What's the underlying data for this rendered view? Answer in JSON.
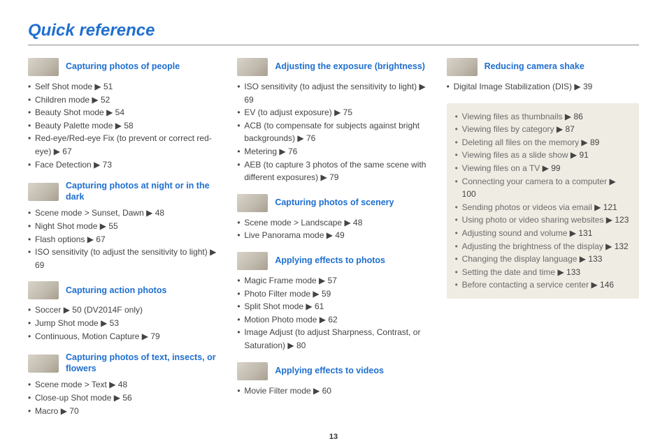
{
  "title": "Quick reference",
  "page_number": "13",
  "columns": [
    [
      {
        "title": "Capturing photos of people",
        "items": [
          {
            "text": "Self Shot mode",
            "page": "51"
          },
          {
            "text": "Children mode",
            "page": "52"
          },
          {
            "text": "Beauty Shot mode",
            "page": "54"
          },
          {
            "text": "Beauty Palette mode",
            "page": "58"
          },
          {
            "text": "Red-eye/Red-eye Fix (to prevent or correct red-eye)",
            "page": "67"
          },
          {
            "text": "Face Detection",
            "page": "73"
          }
        ]
      },
      {
        "title": "Capturing photos at night or in the dark",
        "items": [
          {
            "text": "Scene mode > Sunset, Dawn",
            "page": "48"
          },
          {
            "text": "Night Shot mode",
            "page": "55"
          },
          {
            "text": "Flash options",
            "page": "67"
          },
          {
            "text": "ISO sensitivity (to adjust the sensitivity to light)",
            "page": "69"
          }
        ]
      },
      {
        "title": "Capturing action photos",
        "items": [
          {
            "text": "Soccer ",
            "page": "50 (DV2014F only)"
          },
          {
            "text": "Jump Shot mode",
            "page": "53"
          },
          {
            "text": "Continuous, Motion Capture",
            "page": "79"
          }
        ]
      },
      {
        "title": "Capturing photos of text, insects, or flowers",
        "items": [
          {
            "text": "Scene mode > Text",
            "page": "48"
          },
          {
            "text": "Close-up Shot mode",
            "page": "56"
          },
          {
            "text": "Macro",
            "page": "70"
          }
        ]
      }
    ],
    [
      {
        "title": "Adjusting the exposure (brightness)",
        "items": [
          {
            "text": "ISO sensitivity (to adjust the sensitivity to light)",
            "page": "69"
          },
          {
            "text": "EV (to adjust exposure)",
            "page": "75"
          },
          {
            "text": "ACB (to compensate for subjects against bright backgrounds)",
            "page": "76"
          },
          {
            "text": "Metering",
            "page": "76"
          },
          {
            "text": "AEB (to capture 3 photos of the same scene with different exposures)",
            "page": "79"
          }
        ]
      },
      {
        "title": "Capturing photos of scenery",
        "items": [
          {
            "text": "Scene mode > Landscape",
            "page": "48"
          },
          {
            "text": "Live Panorama mode",
            "page": "49"
          }
        ]
      },
      {
        "title": "Applying effects to photos",
        "items": [
          {
            "text": "Magic Frame mode",
            "page": "57"
          },
          {
            "text": "Photo Filter mode",
            "page": "59"
          },
          {
            "text": "Split Shot mode",
            "page": "61"
          },
          {
            "text": "Motion Photo mode",
            "page": "62"
          },
          {
            "text": "Image Adjust (to adjust Sharpness, Contrast, or Saturation)",
            "page": "80"
          }
        ]
      },
      {
        "title": "Applying effects to videos",
        "items": [
          {
            "text": "Movie Filter mode",
            "page": "60"
          }
        ]
      }
    ],
    [
      {
        "title": "Reducing camera shake",
        "items": [
          {
            "text": "Digital Image Stabilization (DIS)",
            "page": "39"
          }
        ]
      }
    ]
  ],
  "box": {
    "items": [
      {
        "text": "Viewing files as thumbnails",
        "page": "86"
      },
      {
        "text": "Viewing files by category",
        "page": "87"
      },
      {
        "text": "Deleting all files on the memory",
        "page": "89"
      },
      {
        "text": "Viewing files as a slide show",
        "page": "91"
      },
      {
        "text": "Viewing files on a TV",
        "page": "99"
      },
      {
        "text": "Connecting your camera to a computer",
        "page": "100"
      },
      {
        "text": "Sending photos or videos via email",
        "page": "121"
      },
      {
        "text": "Using photo or video sharing websites",
        "page": "123"
      },
      {
        "text": "Adjusting sound and volume",
        "page": "131"
      },
      {
        "text": "Adjusting the brightness of the display",
        "page": "132"
      },
      {
        "text": "Changing the display language",
        "page": "133"
      },
      {
        "text": "Setting the date and time",
        "page": "133"
      },
      {
        "text": "Before contacting a service center",
        "page": "146"
      }
    ]
  }
}
